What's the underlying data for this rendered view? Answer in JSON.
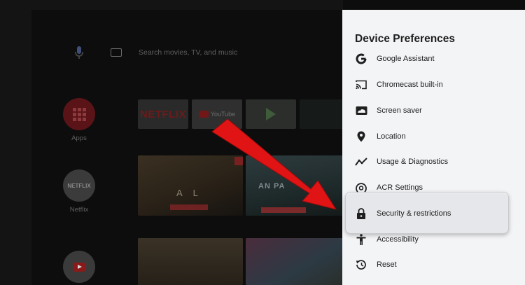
{
  "search": {
    "placeholder": "Search movies, TV, and music"
  },
  "sidebar": {
    "apps_label": "Apps",
    "netflix_label": "Netflix",
    "netflix_logo": "NETFLIX"
  },
  "channels": {
    "netflix_tile": "NETFLIX",
    "youtube_tile": "YouTube"
  },
  "cards": {
    "card1_title": "A L",
    "card2_title": "AN PA"
  },
  "panel": {
    "title": "Device Preferences",
    "items": [
      {
        "label": "Google Assistant",
        "icon": "google-g-icon"
      },
      {
        "label": "Chromecast built-in",
        "icon": "cast-icon"
      },
      {
        "label": "Screen saver",
        "icon": "screen-saver-icon"
      },
      {
        "label": "Location",
        "icon": "location-pin-icon"
      },
      {
        "label": "Usage & Diagnostics",
        "icon": "trend-line-icon"
      },
      {
        "label": "ACR Settings",
        "icon": "acr-icon"
      },
      {
        "label": "Security & restrictions",
        "icon": "lock-icon"
      },
      {
        "label": "Accessibility",
        "icon": "accessibility-icon"
      },
      {
        "label": "Reset",
        "icon": "reset-icon"
      }
    ],
    "selected_index": 6
  },
  "colors": {
    "panel_bg": "#f3f4f6",
    "arrow": "#e01414",
    "home_bg": "#0d0d0e"
  }
}
